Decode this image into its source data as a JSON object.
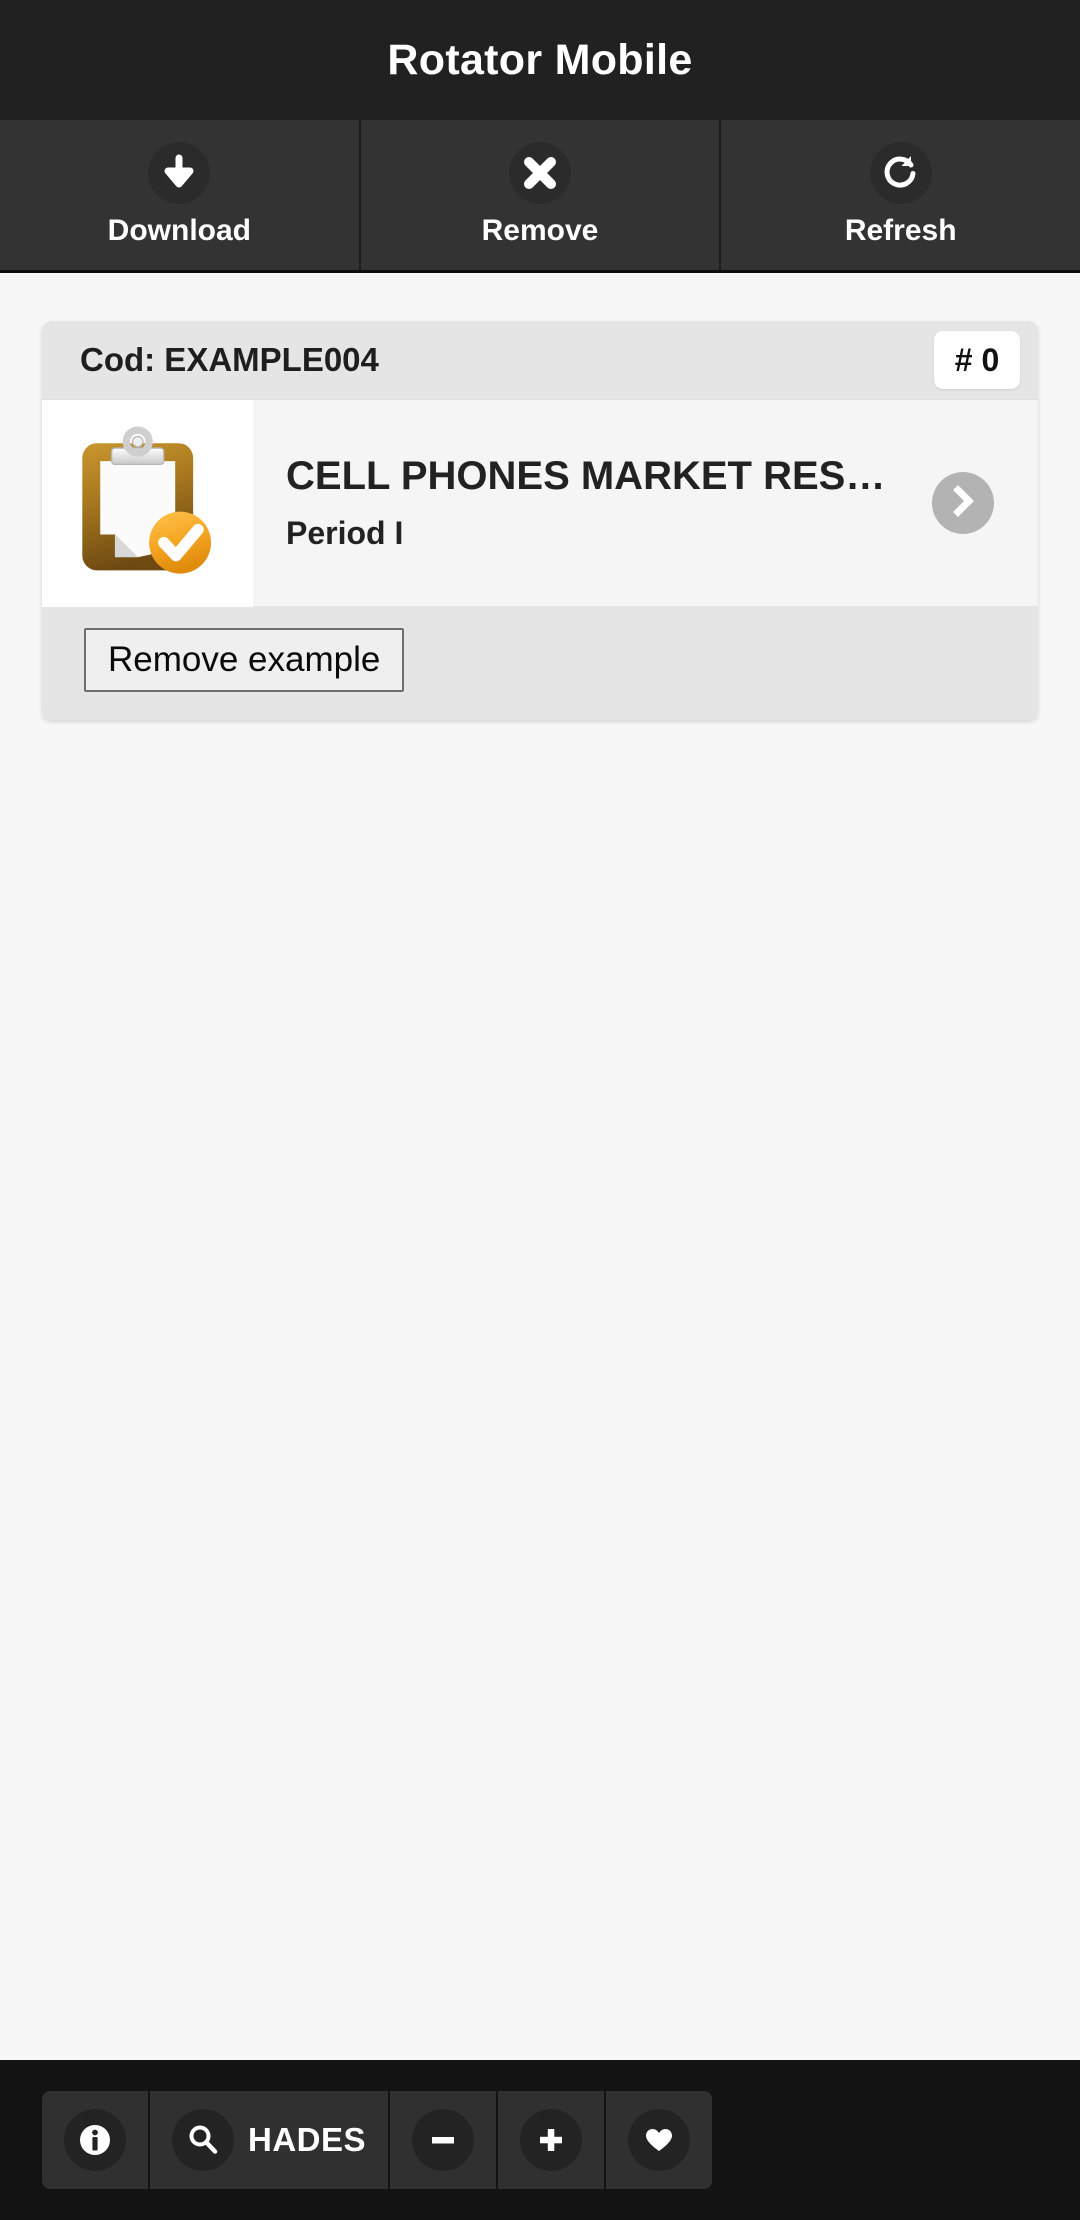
{
  "titlebar": {
    "title": "Rotator Mobile"
  },
  "toolbar": {
    "buttons": [
      {
        "label": "Download",
        "icon": "download-arrow-icon"
      },
      {
        "label": "Remove",
        "icon": "close-x-icon"
      },
      {
        "label": "Refresh",
        "icon": "refresh-icon"
      }
    ]
  },
  "card": {
    "code_label": "Cod: EXAMPLE004",
    "badge": "# 0",
    "thumbnail_icon": "clipboard-checked-icon",
    "title": "CELL PHONES MARKET RES…",
    "subtitle": "Period I",
    "chevron_icon": "chevron-right-icon",
    "remove_example_label": "Remove example"
  },
  "bottombar": {
    "buttons": [
      {
        "icon": "info-icon",
        "label": ""
      },
      {
        "icon": "search-icon",
        "label": "HADES"
      },
      {
        "icon": "minus-icon",
        "label": ""
      },
      {
        "icon": "plus-icon",
        "label": ""
      },
      {
        "icon": "heart-icon",
        "label": ""
      }
    ]
  },
  "colors": {
    "titlebar_bg": "#212121",
    "toolbar_bg": "#333333",
    "page_bg": "#f7f7f7",
    "card_bg": "#f5f5f5",
    "card_header_bg": "#e5e5e5",
    "bottombar_bg": "#131313",
    "chevron_bg": "#b3b3b3",
    "clipboard_brown": "#a0741f",
    "check_orange": "#f5a623"
  }
}
